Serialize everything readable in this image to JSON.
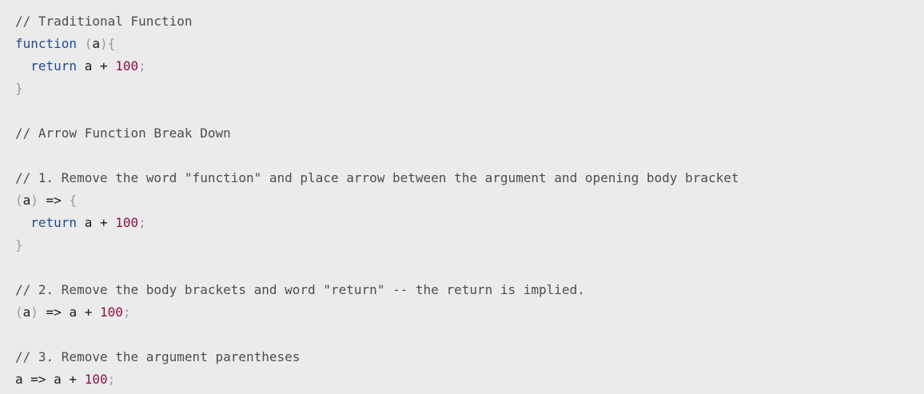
{
  "colors": {
    "background": "#ebebeb",
    "comment": "#4d4d4d",
    "keyword": "#1f4a8c",
    "number": "#8c0f4a",
    "punctuation": "#9a9a9a",
    "identifier": "#1b1b1b",
    "operator": "#1b1b1b"
  },
  "code": {
    "language": "javascript",
    "lines": [
      [
        {
          "t": "// Traditional Function",
          "k": "comment"
        }
      ],
      [
        {
          "t": "function",
          "k": "keyword"
        },
        {
          "t": " ",
          "k": "ident"
        },
        {
          "t": "(",
          "k": "punct"
        },
        {
          "t": "a",
          "k": "ident"
        },
        {
          "t": "){",
          "k": "punct"
        }
      ],
      [
        {
          "t": "  ",
          "k": "ident"
        },
        {
          "t": "return",
          "k": "keyword"
        },
        {
          "t": " a + ",
          "k": "ident"
        },
        {
          "t": "100",
          "k": "number"
        },
        {
          "t": ";",
          "k": "punct"
        }
      ],
      [
        {
          "t": "}",
          "k": "punct"
        }
      ],
      [],
      [
        {
          "t": "// Arrow Function Break Down",
          "k": "comment"
        }
      ],
      [],
      [
        {
          "t": "// 1. Remove the word \"function\" and place arrow between the argument and opening body bracket",
          "k": "comment"
        }
      ],
      [
        {
          "t": "(",
          "k": "punct"
        },
        {
          "t": "a",
          "k": "ident"
        },
        {
          "t": ")",
          "k": "punct"
        },
        {
          "t": " => ",
          "k": "op"
        },
        {
          "t": "{",
          "k": "punct"
        }
      ],
      [
        {
          "t": "  ",
          "k": "ident"
        },
        {
          "t": "return",
          "k": "keyword"
        },
        {
          "t": " a + ",
          "k": "ident"
        },
        {
          "t": "100",
          "k": "number"
        },
        {
          "t": ";",
          "k": "punct"
        }
      ],
      [
        {
          "t": "}",
          "k": "punct"
        }
      ],
      [],
      [
        {
          "t": "// 2. Remove the body brackets and word \"return\" -- the return is implied.",
          "k": "comment"
        }
      ],
      [
        {
          "t": "(",
          "k": "punct"
        },
        {
          "t": "a",
          "k": "ident"
        },
        {
          "t": ")",
          "k": "punct"
        },
        {
          "t": " => a + ",
          "k": "op"
        },
        {
          "t": "100",
          "k": "number"
        },
        {
          "t": ";",
          "k": "punct"
        }
      ],
      [],
      [
        {
          "t": "// 3. Remove the argument parentheses",
          "k": "comment"
        }
      ],
      [
        {
          "t": "a => a + ",
          "k": "ident"
        },
        {
          "t": "100",
          "k": "number"
        },
        {
          "t": ";",
          "k": "punct"
        }
      ]
    ]
  }
}
